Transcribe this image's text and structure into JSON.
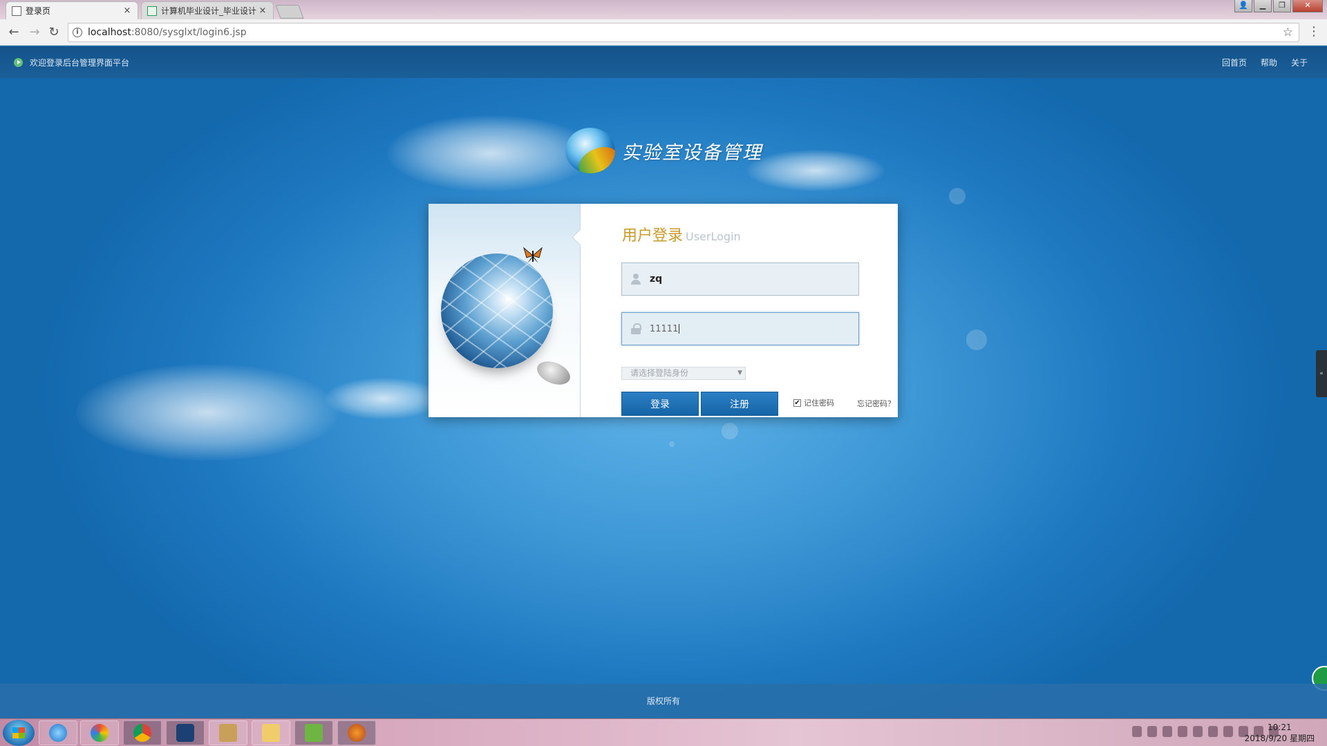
{
  "browser": {
    "tabs": [
      {
        "title": "登录页",
        "close": "×",
        "active": true
      },
      {
        "title": "计算机毕业设计_毕业设计",
        "close": "×",
        "active": false
      }
    ],
    "window_controls": {
      "user": "👤",
      "minimize": "▁",
      "maximize": "❐",
      "close": "✕"
    },
    "nav": {
      "back": "←",
      "forward": "→",
      "reload": "↻"
    },
    "url": {
      "host": "localhost",
      "path": ":8080/sysglxt/login6.jsp"
    },
    "bookmark_icon": "star-icon",
    "menu_icon": "menu-dots-icon"
  },
  "page": {
    "topbar": {
      "welcome": "欢迎登录后台管理界面平台",
      "nav": [
        "回首页",
        "帮助",
        "关于"
      ]
    },
    "logo_text": "实验室设备管理",
    "login": {
      "title_cn": "用户登录",
      "title_en": "UserLogin",
      "username_value": "zq",
      "password_value": "11111",
      "role_placeholder": "请选择登陆身份",
      "login_button": "登录",
      "register_button": "注册",
      "remember_label": "记住密码",
      "remember_checked": true,
      "forgot_link": "忘记密码？"
    },
    "side_tab": "«",
    "footer": "版权所有"
  },
  "taskbar": {
    "apps": [
      "windows-start",
      "ie",
      "app-colorful",
      "chrome",
      "eclipse-like",
      "tools",
      "file-explorer",
      "notepad-green",
      "app-orange"
    ],
    "clock_time": "10:21",
    "clock_date": "2018/9/20 星期四"
  },
  "colors": {
    "page_blue": "#1f7fc4",
    "topbar": "#15538a",
    "button": "#1565a8",
    "title_gold": "#c89a2a"
  }
}
